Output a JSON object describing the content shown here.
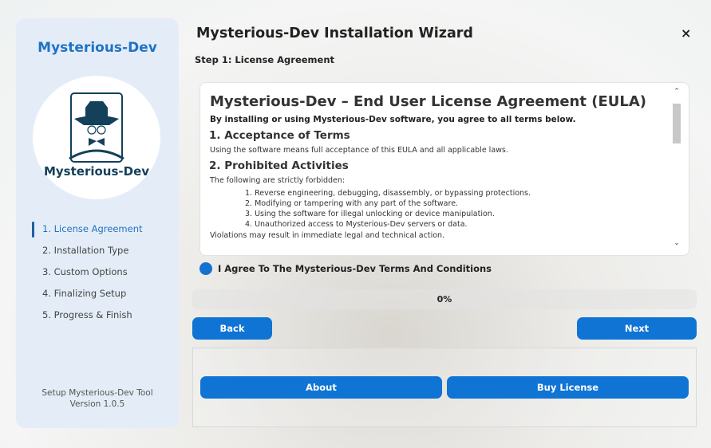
{
  "sidebar": {
    "brand": "Mysterious-Dev",
    "logo_text": "Mysterious-Dev",
    "steps": [
      {
        "label": "1. License Agreement",
        "active": true
      },
      {
        "label": "2. Installation Type"
      },
      {
        "label": "3. Custom Options"
      },
      {
        "label": "4. Finalizing Setup"
      },
      {
        "label": "5. Progress & Finish"
      }
    ],
    "footer_line1": "Setup Mysterious-Dev Tool",
    "footer_line2": "Version 1.0.5"
  },
  "header": {
    "title": "Mysterious-Dev Installation Wizard",
    "step": "Step 1: License Agreement",
    "close": "×"
  },
  "eula": {
    "title": "Mysterious-Dev – End User License Agreement (EULA)",
    "lead": "By installing or using Mysterious-Dev software, you agree to all terms below.",
    "s1_heading": "1. Acceptance of Terms",
    "s1_text": "Using the software means full acceptance of this EULA and all applicable laws.",
    "s2_heading": "2. Prohibited Activities",
    "s2_text": "The following are strictly forbidden:",
    "s2_items": [
      "1. Reverse engineering, debugging, disassembly, or bypassing protections.",
      "2. Modifying or tampering with any part of the software.",
      "3. Using the software for illegal unlocking or device manipulation.",
      "4. Unauthorized access to Mysterious-Dev servers or data."
    ],
    "s2_footer": "Violations may result in immediate legal and technical action."
  },
  "agree_label": "I Agree To The Mysterious-Dev Terms And Conditions",
  "progress": {
    "value": 0,
    "label": "0%"
  },
  "buttons": {
    "back": "Back",
    "next": "Next",
    "about": "About",
    "buy": "Buy License"
  },
  "colors": {
    "accent": "#0f74d4",
    "brand": "#1f73c4"
  }
}
